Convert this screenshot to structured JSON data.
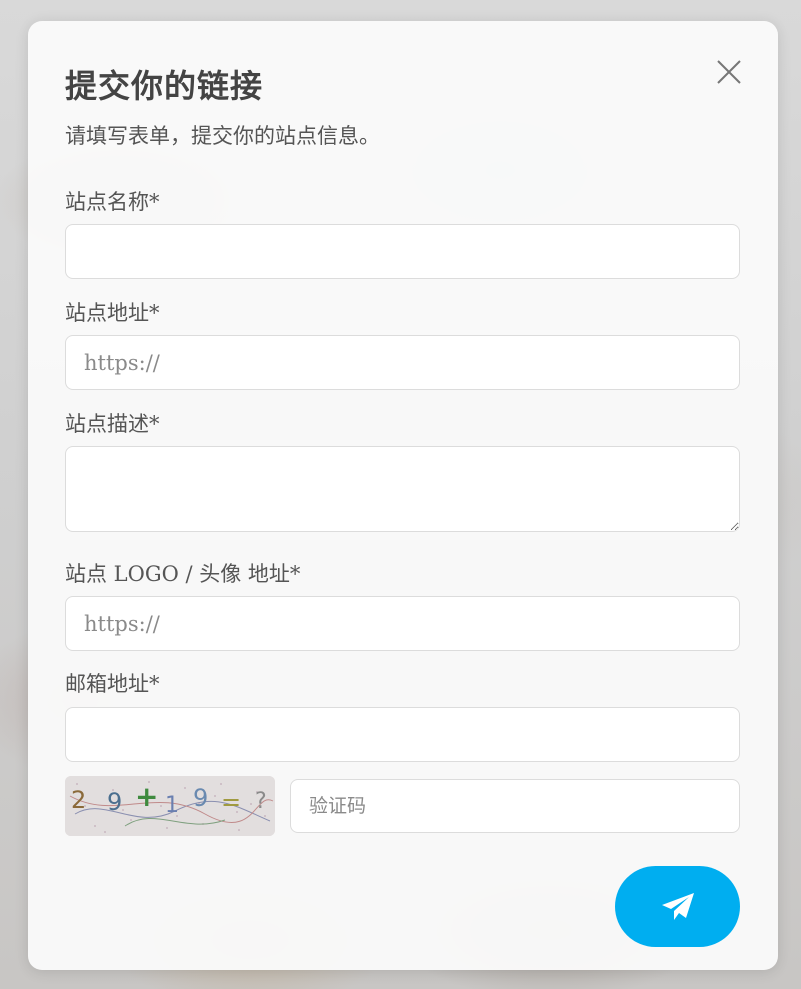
{
  "modal": {
    "title": "提交你的链接",
    "subtitle": "请填写表单，提交你的站点信息。"
  },
  "form": {
    "site_name": {
      "label": "站点名称*",
      "value": "",
      "placeholder": ""
    },
    "site_url": {
      "label": "站点地址*",
      "value": "",
      "placeholder": "https://"
    },
    "site_description": {
      "label": "站点描述*",
      "value": "",
      "placeholder": ""
    },
    "site_logo": {
      "label": "站点 LOGO / 头像 地址*",
      "value": "",
      "placeholder": "https://"
    },
    "email": {
      "label": "邮箱地址*",
      "value": "",
      "placeholder": ""
    },
    "captcha": {
      "image_text": "2 9 + 1 9 = ?",
      "placeholder": "验证码",
      "value": ""
    }
  },
  "icons": {
    "close": "close-icon",
    "submit": "send-icon"
  },
  "colors": {
    "accent": "#00aef0",
    "text": "#555555",
    "title": "#444444"
  }
}
